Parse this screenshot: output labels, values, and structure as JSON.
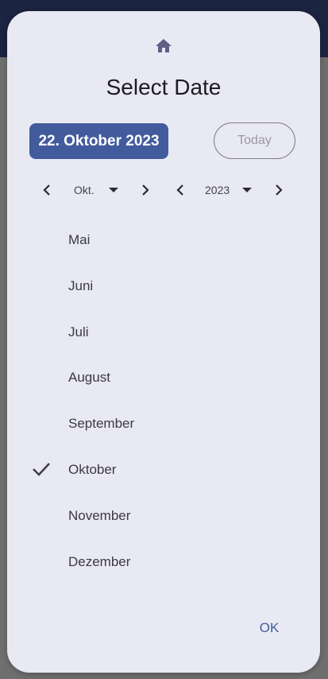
{
  "dialog": {
    "title": "Select Date",
    "home_icon": "home-icon",
    "selected_date": "22. Oktober 2023",
    "today_label": "Today",
    "ok_label": "OK"
  },
  "nav": {
    "month_label": "Okt.",
    "year_label": "2023"
  },
  "months": [
    {
      "label": "Mai",
      "selected": false
    },
    {
      "label": "Juni",
      "selected": false
    },
    {
      "label": "Juli",
      "selected": false
    },
    {
      "label": "August",
      "selected": false
    },
    {
      "label": "September",
      "selected": false
    },
    {
      "label": "Oktober",
      "selected": true
    },
    {
      "label": "November",
      "selected": false
    },
    {
      "label": "Dezember",
      "selected": false
    }
  ],
  "colors": {
    "accent": "#425b9c",
    "dialog_bg": "#e9e9f4",
    "topbar": "#1b2440",
    "scrim": "#6f6f6f"
  }
}
